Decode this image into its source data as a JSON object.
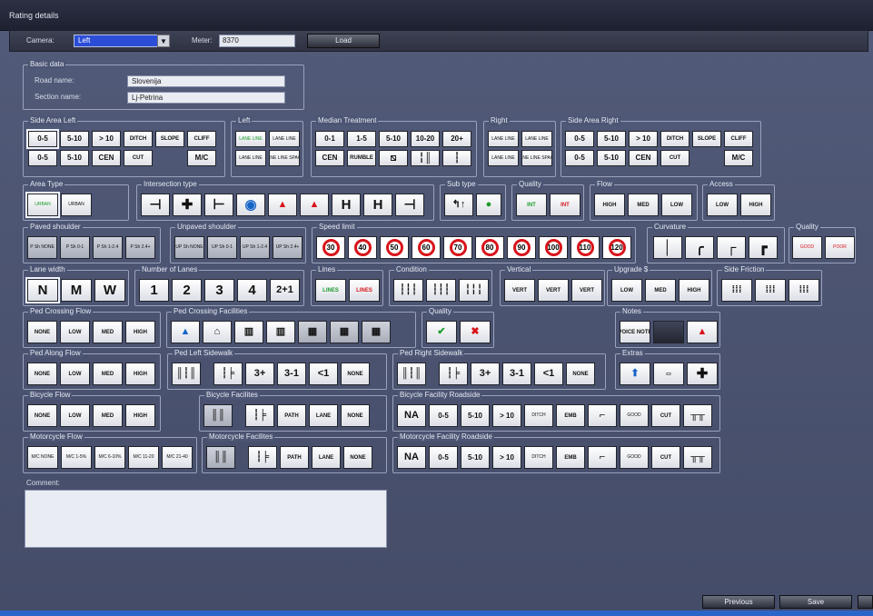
{
  "title": "Rating details",
  "toolbar": {
    "camera_label": "Camera:",
    "camera_value": "Left",
    "meter_label": "Meter:",
    "meter_value": "8370",
    "load_label": "Load"
  },
  "basic": {
    "title": "Basic data",
    "road_label": "Road name:",
    "road_value": "Slovenija",
    "section_label": "Section name:",
    "section_value": "Lj-Petrina"
  },
  "groups": {
    "side_left": {
      "title": "Side Area Left",
      "row1": [
        "0-5",
        "5-10",
        "> 10",
        "DITCH",
        "SLOPE",
        "CLIFF"
      ],
      "row2": [
        "0-5",
        "5-10",
        "CEN",
        "CUT",
        "M/C"
      ]
    },
    "left": {
      "title": "Left",
      "row1": [
        "LANE LINE",
        "LANE LINE"
      ],
      "row2": [
        "LANE LINE",
        "LANE LINE SPACE"
      ]
    },
    "median": {
      "title": "Median Treatment",
      "row1": [
        "0-1",
        "1-5",
        "5-10",
        "10-20",
        "20+"
      ],
      "row2": [
        "CEN",
        "RUMBLE"
      ]
    },
    "right": {
      "title": "Right",
      "row1": [
        "LANE LINE",
        "LANE LINE"
      ],
      "row2": [
        "LANE LINE",
        "LANE LINE SPACE"
      ]
    },
    "side_right": {
      "title": "Side Area Right",
      "row1": [
        "0-5",
        "5-10",
        "> 10",
        "DITCH",
        "SLOPE",
        "CLIFF"
      ],
      "row2": [
        "0-5",
        "5-10",
        "CEN",
        "CUT",
        "M/C"
      ]
    },
    "area_type": {
      "title": "Area Type",
      "items": [
        "URBAN",
        "URBAN"
      ]
    },
    "intersection": {
      "title": "Intersection type",
      "items": [
        "H",
        "H"
      ]
    },
    "sub_type": {
      "title": "Sub type"
    },
    "quality1": {
      "title": "Quality",
      "items": [
        "INT",
        "INT"
      ]
    },
    "flow": {
      "title": "Flow",
      "items": [
        "HIGH",
        "MED",
        "LOW"
      ]
    },
    "access": {
      "title": "Access",
      "items": [
        "LOW",
        "HIGH"
      ]
    },
    "paved": {
      "title": "Paved shoulder",
      "items": [
        "P Sh NONE",
        "P Sh 0-1",
        "P Sh 1-2.4",
        "P Sh 2.4+"
      ]
    },
    "unpaved": {
      "title": "Unpaved shoulder",
      "items": [
        "UP Sh NONE",
        "UP Sh 0-1",
        "UP Sh 1-2.4",
        "UP Sh 2.4+"
      ]
    },
    "speed": {
      "title": "Speed limit",
      "items": [
        "30",
        "40",
        "50",
        "60",
        "70",
        "80",
        "90",
        "100",
        "110",
        "120"
      ]
    },
    "curvature": {
      "title": "Curvature"
    },
    "quality2": {
      "title": "Quality",
      "items": [
        "GOOD",
        "POOR"
      ]
    },
    "lane_width": {
      "title": "Lane width",
      "items": [
        "N",
        "M",
        "W"
      ],
      "sub": "LANE"
    },
    "lanes": {
      "title": "Number of Lanes",
      "items": [
        "1",
        "2",
        "3",
        "4",
        "2+1"
      ],
      "sub": "LANE"
    },
    "lines": {
      "title": "Lines",
      "items": [
        "LINES",
        "LINES"
      ]
    },
    "condition": {
      "title": "Condition"
    },
    "vertical": {
      "title": "Vertical",
      "items": [
        "VERT",
        "VERT",
        "VERT"
      ]
    },
    "upgrade": {
      "title": "Upgrade $",
      "items": [
        "LOW",
        "MED",
        "HIGH"
      ]
    },
    "side_friction": {
      "title": "Side Friction"
    },
    "ped_crossing_flow": {
      "title": "Ped Crossing Flow",
      "items": [
        "NONE",
        "LOW",
        "MED",
        "HIGH"
      ]
    },
    "ped_crossing_fac": {
      "title": "Ped Crossing Facilities"
    },
    "quality3": {
      "title": "Quality"
    },
    "notes": {
      "title": "Notes",
      "items": [
        "VOICE NOTE"
      ]
    },
    "ped_along": {
      "title": "Ped Along Flow",
      "items": [
        "NONE",
        "LOW",
        "MED",
        "HIGH"
      ]
    },
    "ped_left": {
      "title": "Ped Left Sidewalk",
      "items": [
        "3+",
        "3-1",
        "<1",
        "NONE"
      ]
    },
    "ped_right": {
      "title": "Ped Right Sidewalk",
      "items": [
        "3+",
        "3-1",
        "<1",
        "NONE"
      ]
    },
    "extras": {
      "title": "Extras"
    },
    "bike_flow": {
      "title": "Bicycle Flow",
      "items": [
        "NONE",
        "LOW",
        "MED",
        "HIGH"
      ]
    },
    "bike_fac": {
      "title": "Bicycle Facilites",
      "items": [
        "PATH",
        "LANE",
        "NONE"
      ]
    },
    "bike_road": {
      "title": "Bicycle Facility Roadside",
      "items": [
        "NA",
        "0-5",
        "5-10",
        "> 10",
        "DITCH",
        "EMB",
        "GOOD",
        "CUT"
      ]
    },
    "moto_flow": {
      "title": "Motorcycle Flow",
      "items": [
        "M/C NONE",
        "M/C 1-5%",
        "M/C 6-10%",
        "M/C 11-20",
        "M/C 21-40"
      ]
    },
    "moto_fac": {
      "title": "Motorcycle Facilites",
      "items": [
        "PATH",
        "LANE",
        "NONE"
      ]
    },
    "moto_road": {
      "title": "Motorcycle Facility Roadside",
      "items": [
        "NA",
        "0-5",
        "5-10",
        "> 10",
        "DITCH",
        "EMB",
        "GOOD",
        "CUT"
      ]
    }
  },
  "comment_label": "Comment:",
  "footer": {
    "previous": "Previous",
    "save": "Save"
  },
  "colors": {
    "accent": "#2b4dd8",
    "sign_red": "#d8141b"
  }
}
